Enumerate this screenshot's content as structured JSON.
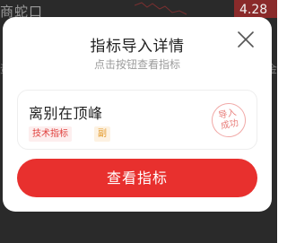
{
  "background": {
    "title": "商蛇口",
    "price": "4.28",
    "sub_left": "资",
    "sub_right": "金"
  },
  "modal": {
    "title": "指标导入详情",
    "subtitle": "点击按钮查看指标",
    "close_icon": "close-icon"
  },
  "indicator": {
    "name": "离别在顶峰",
    "tag_type": "技术指标",
    "tag_kind": "副",
    "stamp_line1": "导入",
    "stamp_line2": "成功"
  },
  "actions": {
    "view_label": "查看指标"
  },
  "colors": {
    "accent": "#e8302e",
    "overlay": "#2a2a2a",
    "stamp": "#e9807d"
  }
}
